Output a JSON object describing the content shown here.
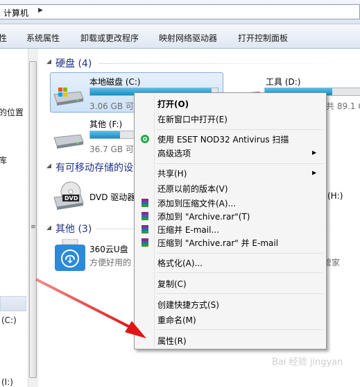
{
  "address": {
    "crumb": "计算机",
    "chevron": "▶"
  },
  "toolbar": {
    "items": [
      "性",
      "系统属性",
      "卸载或更改程序",
      "映射网络驱动器",
      "打开控制面板"
    ]
  },
  "nav": {
    "items": [
      "的位置",
      "库",
      "(C:)",
      "(I:)"
    ]
  },
  "groups": {
    "hdd": {
      "title": "硬盘 (4)"
    },
    "removable": {
      "title": "有可移动存储的设"
    },
    "other": {
      "title": "其他 (3)"
    }
  },
  "drives": {
    "c": {
      "name": "本地磁盘 (C:)",
      "free": "3.06 GB 可",
      "used_fraction": 0.95
    },
    "d": {
      "name": "工具 (D:)",
      "free": "共 89.1 G",
      "used_fraction": 0.7
    },
    "f": {
      "name": "其他 (F:)",
      "free": "36.7 GB 可",
      "used_fraction": 0.55
    },
    "dvd": {
      "name": "DVD 驱动器",
      "icon_text": "DVD"
    },
    "h": {
      "name": "(H:)"
    },
    "cloud": {
      "name": "360云U盘",
      "desc": "方便好用的",
      "right_text": "管家"
    }
  },
  "menu": {
    "items": [
      {
        "label": "打开(O)",
        "bold": true
      },
      {
        "label": "在新窗口中打开(E)"
      },
      {
        "label": "使用 ESET NOD32 Antivirus 扫描",
        "icon": "eset-icon"
      },
      {
        "label": "高级选项",
        "submenu": true
      },
      {
        "label": "共享(H)",
        "submenu": true
      },
      {
        "label": "还原以前的版本(V)"
      },
      {
        "label": "添加到压缩文件(A)...",
        "icon": "winrar-icon"
      },
      {
        "label": "添加到 \"Archive.rar\"(T)",
        "icon": "winrar-icon"
      },
      {
        "label": "压缩并 E-mail...",
        "icon": "winrar-icon"
      },
      {
        "label": "压缩到 \"Archive.rar\" 并 E-mail",
        "icon": "winrar-icon"
      },
      {
        "label": "格式化(A)..."
      },
      {
        "label": "复制(C)"
      },
      {
        "label": "创建快捷方式(S)"
      },
      {
        "label": "重命名(M)"
      },
      {
        "label": "属性(R)"
      }
    ],
    "submenu_arrow": "▶"
  },
  "watermark": "Bai 经验 jingyan",
  "colors": {
    "accent": "#1e3287",
    "arrow": "#e02020",
    "bar": "#26a0da"
  }
}
